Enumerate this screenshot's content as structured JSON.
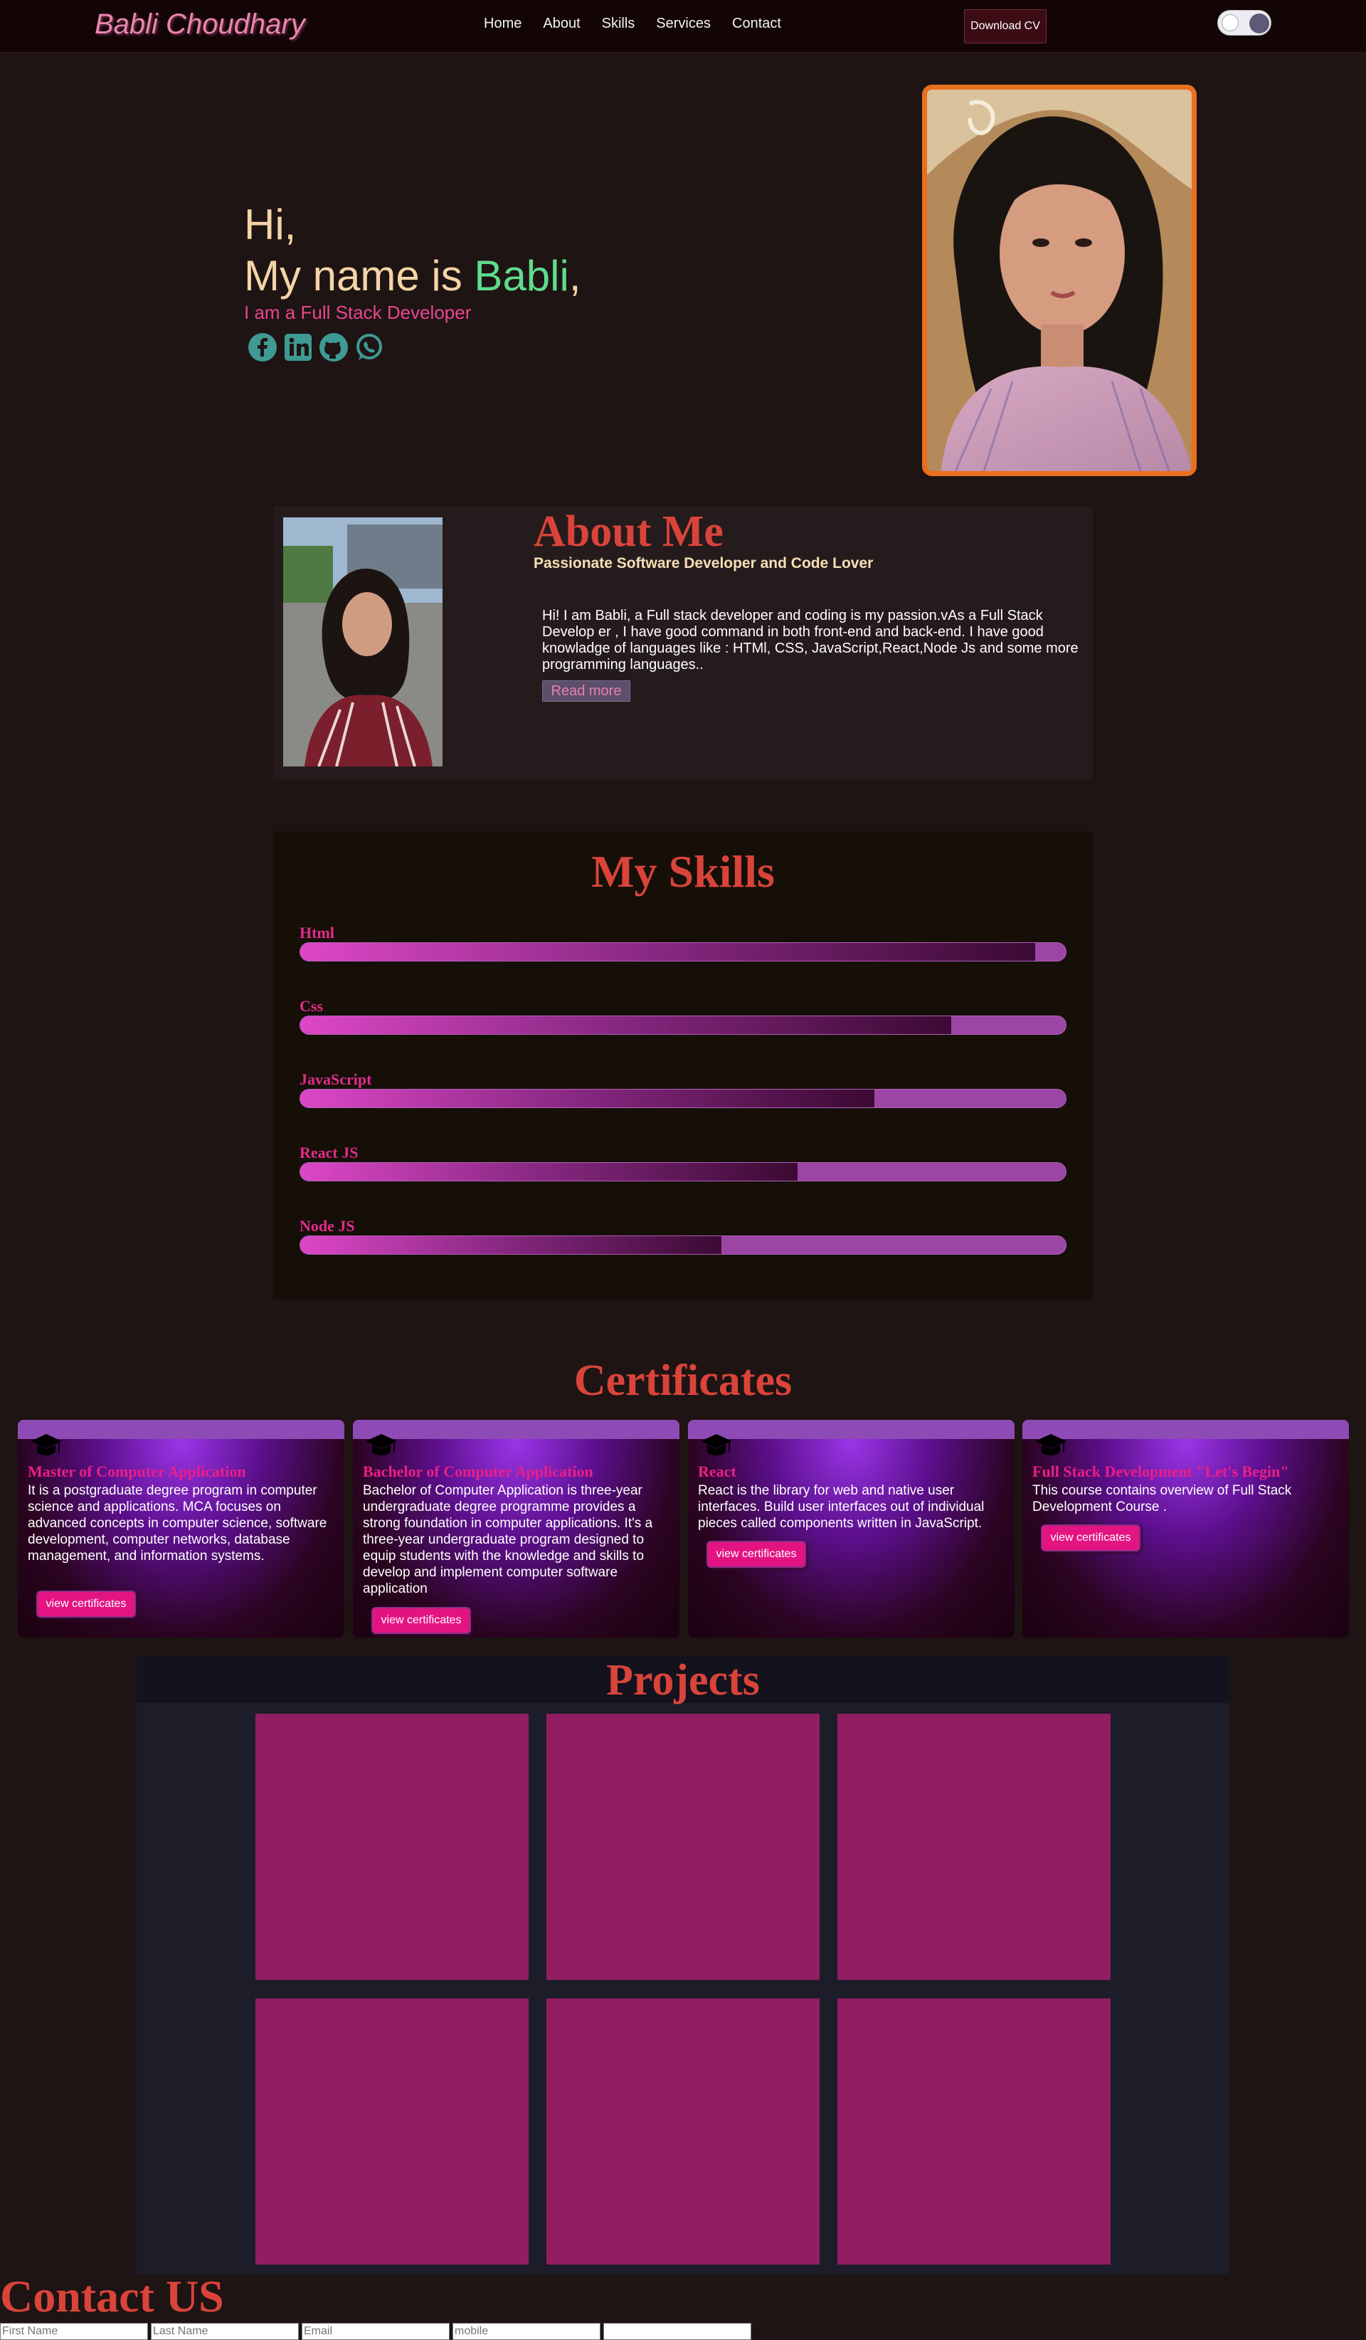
{
  "navbar": {
    "brand": "Babli Choudhary",
    "links": [
      "Home",
      "About",
      "Skills",
      "Services",
      "Contact"
    ],
    "download_cv": "Download CV"
  },
  "hero": {
    "greeting": "Hi,",
    "name_prefix": "My name is ",
    "name": "Babli",
    "name_suffix": ",",
    "role": "I am a Full Stack Developer",
    "socials": [
      "facebook-icon",
      "linkedin-icon",
      "github-icon",
      "whatsapp-icon"
    ]
  },
  "about": {
    "title": "About Me",
    "tagline": "Passionate Software Developer and Code Lover",
    "description": "Hi! I am Babli, a Full stack developer and coding is my passion.vAs a Full Stack Develop er , I have good command in both front-end and back-end. I have good knowladge of languages like : HTMl, CSS, JavaScript,React,Node Js and some more programming languages..",
    "read_more": "Read more"
  },
  "skills": {
    "title": "My Skills",
    "items": [
      {
        "name": "Html",
        "level": 0.96
      },
      {
        "name": "Css",
        "level": 0.85
      },
      {
        "name": "JavaScript",
        "level": 0.75
      },
      {
        "name": "React JS",
        "level": 0.65
      },
      {
        "name": "Node JS",
        "level": 0.55
      }
    ]
  },
  "certificates": {
    "title": "Certificates",
    "items": [
      {
        "title": "Master of Computer Application",
        "description": "It is a postgraduate degree program in computer science and applications. MCA focuses on advanced concepts in computer science, software development, computer networks, database management, and information systems.",
        "button": "view certificates"
      },
      {
        "title": "Bachelor of Computer Application",
        "description": "Bachelor of Computer Application is three-year undergraduate degree programme provides a strong foundation in computer applications. It's a three-year undergraduate program designed to equip students with the knowledge and skills to develop and implement computer software application",
        "button": "view certificates"
      },
      {
        "title": "React",
        "description": "React is the library for web and native user interfaces. Build user interfaces out of individual pieces called components written in JavaScript.",
        "button": "view certificates"
      },
      {
        "title": "Full Stack Development \"Let's Begin\"",
        "description": "This course contains overview of Full Stack Development Course .",
        "button": "view certificates"
      }
    ]
  },
  "projects": {
    "title": "Projects",
    "count": 6
  },
  "contact": {
    "title": "Contact US",
    "placeholders": [
      "First Name",
      "Last Name",
      "Email",
      "mobile",
      ""
    ]
  },
  "colors": {
    "accent_red": "#d9443a",
    "pink": "#e31482",
    "project_tile": "#911d62",
    "photo_border": "#ea6f1e",
    "name_green": "#5fdc8d"
  }
}
